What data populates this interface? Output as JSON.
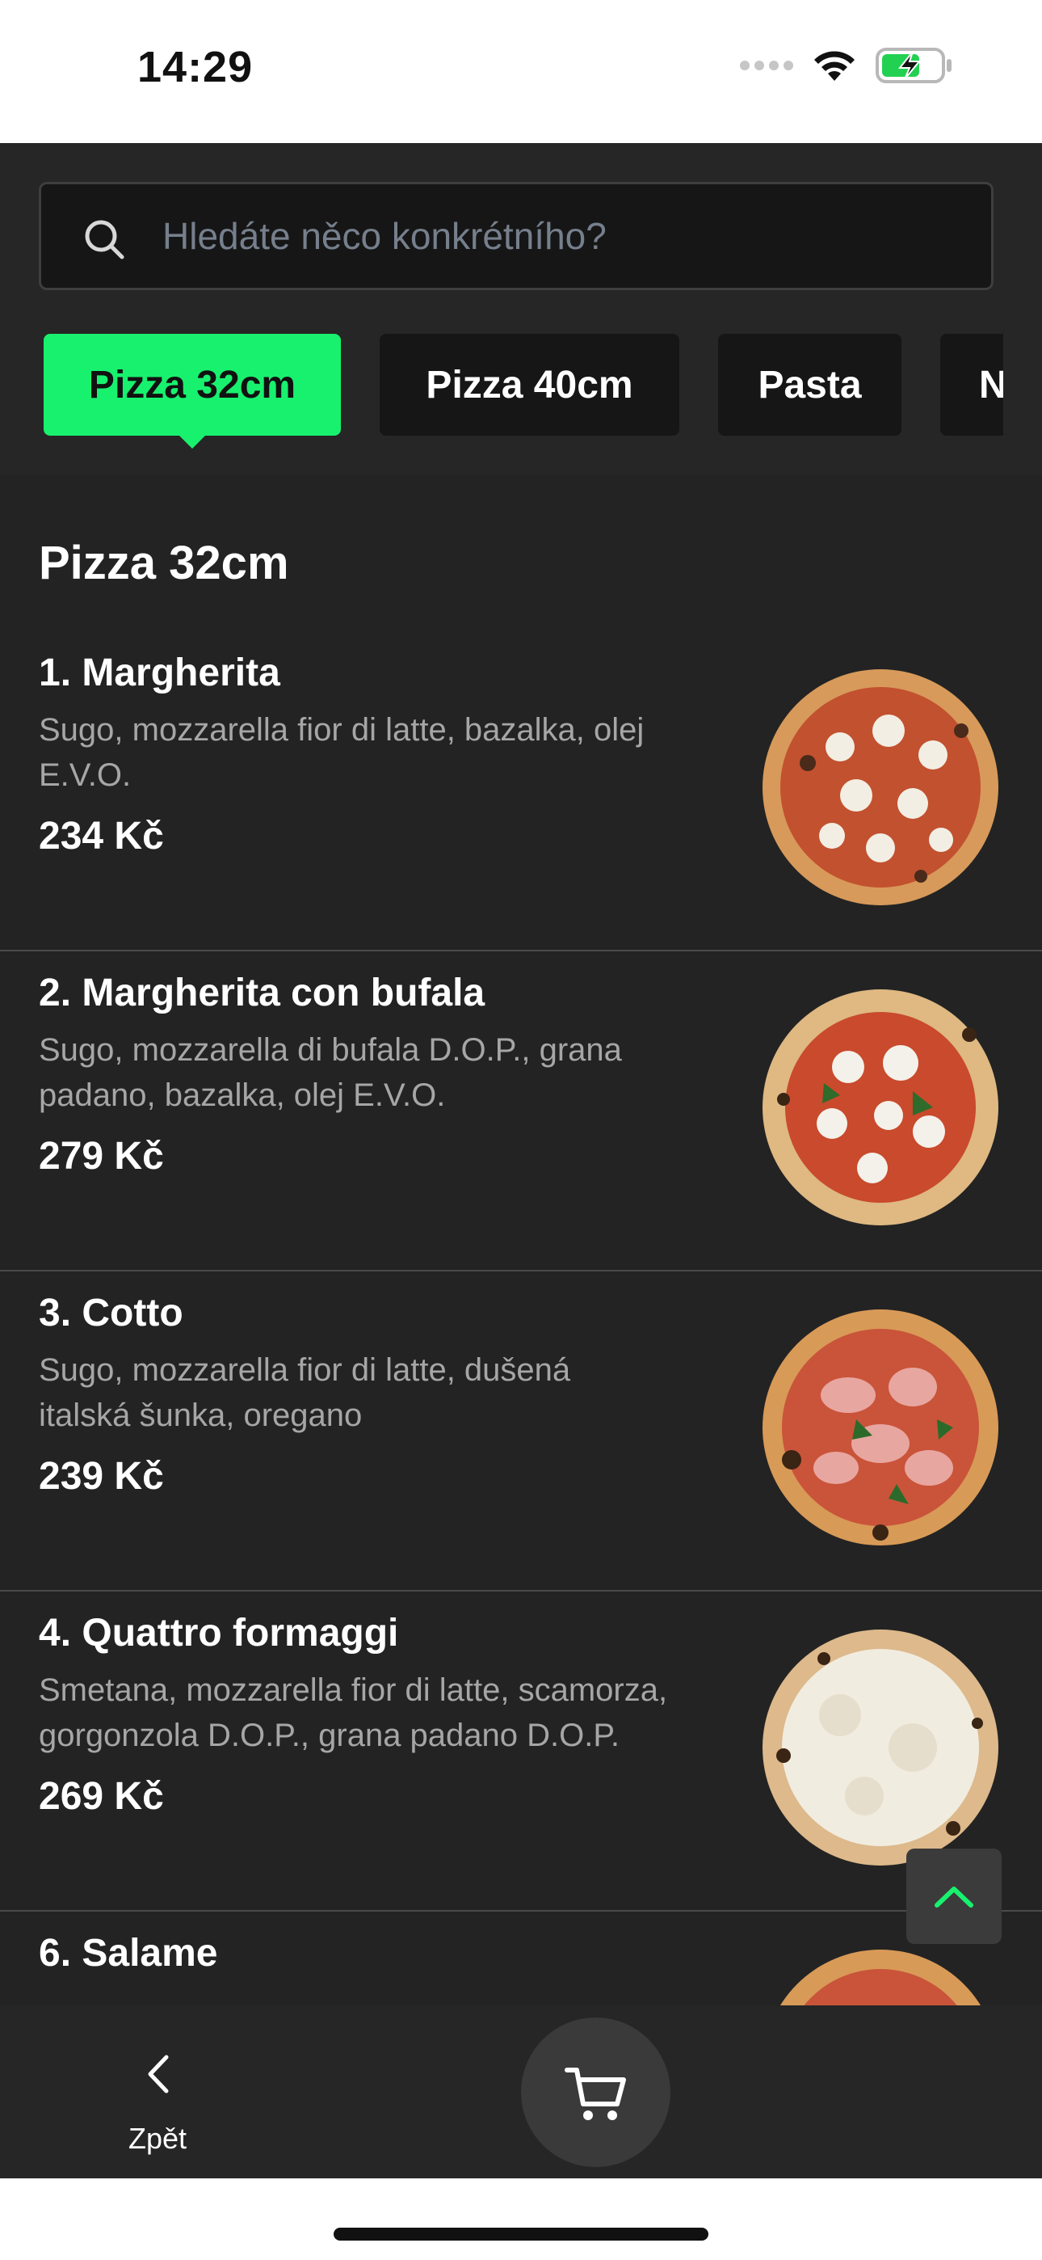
{
  "status": {
    "time": "14:29"
  },
  "search": {
    "placeholder": "Hledáte něco konkrétního?"
  },
  "tabs": [
    {
      "label": "Pizza 32cm",
      "active": true
    },
    {
      "label": "Pizza 40cm",
      "active": false
    },
    {
      "label": "Pasta",
      "active": false
    },
    {
      "label": "N",
      "active": false
    }
  ],
  "section": {
    "title": "Pizza 32cm"
  },
  "items": [
    {
      "name": "1. Margherita",
      "desc_line1": "Sugo, mozzarella fior di latte, bazalka, olej",
      "desc_line2": "E.V.O.",
      "price": "234 Kč"
    },
    {
      "name": "2. Margherita con bufala",
      "desc_line1": "Sugo, mozzarella di bufala D.O.P., grana",
      "desc_line2": "padano, bazalka, olej E.V.O.",
      "price": "279 Kč"
    },
    {
      "name": "3. Cotto",
      "desc_line1": "Sugo, mozzarella fior di latte, dušená",
      "desc_line2": "italská šunka, oregano",
      "price": "239 Kč"
    },
    {
      "name": "4. Quattro formaggi",
      "desc_line1": "Smetana, mozzarella fior di latte, scamorza,",
      "desc_line2": "gorgonzola D.O.P., grana padano D.O.P.",
      "price": "269 Kč"
    },
    {
      "name": "6. Salame"
    }
  ],
  "bottom": {
    "back_label": "Zpět"
  },
  "colors": {
    "accent": "#18f16e",
    "background": "#262626",
    "tab_bg": "#161616"
  },
  "icons": [
    "search-icon",
    "chevron-up-icon",
    "chevron-left-icon",
    "cart-icon",
    "wifi-icon",
    "battery-charging-icon"
  ]
}
